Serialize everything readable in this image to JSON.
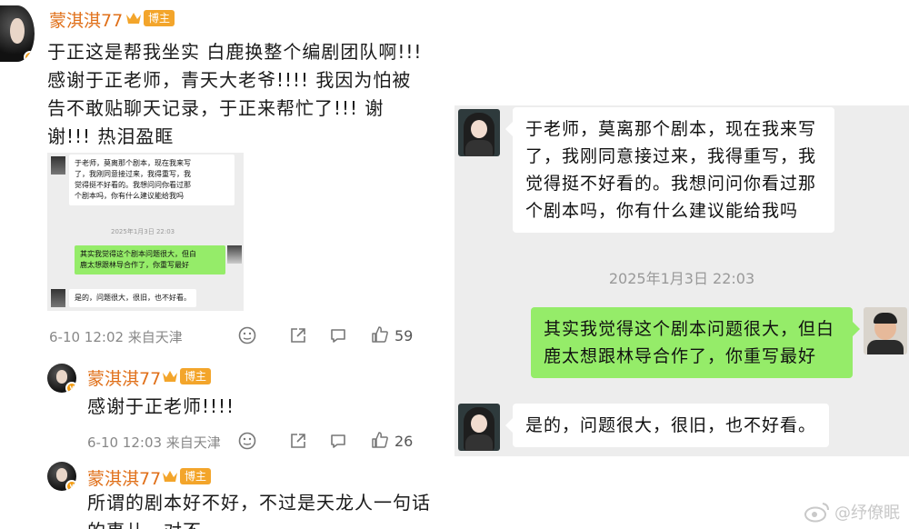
{
  "comments": [
    {
      "username": "蒙淇淇77",
      "tag": "博主",
      "lines": [
        "于正这是帮我坐实 白鹿换整个编剧团队啊!!!",
        "感谢于正老师，青天大老爷!!!! 我因为怕被",
        "告不敢贴聊天记录，于正来帮忙了!!! 谢",
        "谢!!! 热泪盈眶"
      ],
      "time_location": "6-10 12:02 来自天津",
      "likes": "59"
    },
    {
      "username": "蒙淇淇77",
      "tag": "博主",
      "lines": [
        "感谢于正老师!!!!"
      ],
      "time_location": "6-10 12:03 来自天津",
      "likes": "26"
    },
    {
      "username": "蒙淇淇77",
      "tag": "博主",
      "lines": [
        "所谓的剧本好不好，不过是天龙人一句话",
        "的事儿，对不"
      ]
    }
  ],
  "chat": {
    "msg1_lines": [
      "于老师，莫离那个剧本，现在我来写",
      "了，我刚同意接过来，我得重写，我",
      "觉得挺不好看的。我想问问你看过那",
      "个剧本吗，你有什么建议能给我吗"
    ],
    "timestamp": "2025年1月3日 22:03",
    "msg2_lines": [
      "其实我觉得这个剧本问题很大，但白",
      "鹿太想跟林导合作了，你重写最好"
    ],
    "msg3_lines": [
      "是的，问题很大，很旧，也不好看。"
    ]
  },
  "watermark": "@纾僚眠",
  "colors": {
    "username": "#e0701a",
    "tag_bg": "#f3a52b",
    "bubble_green": "#95ec69",
    "chat_bg": "#ededed"
  }
}
